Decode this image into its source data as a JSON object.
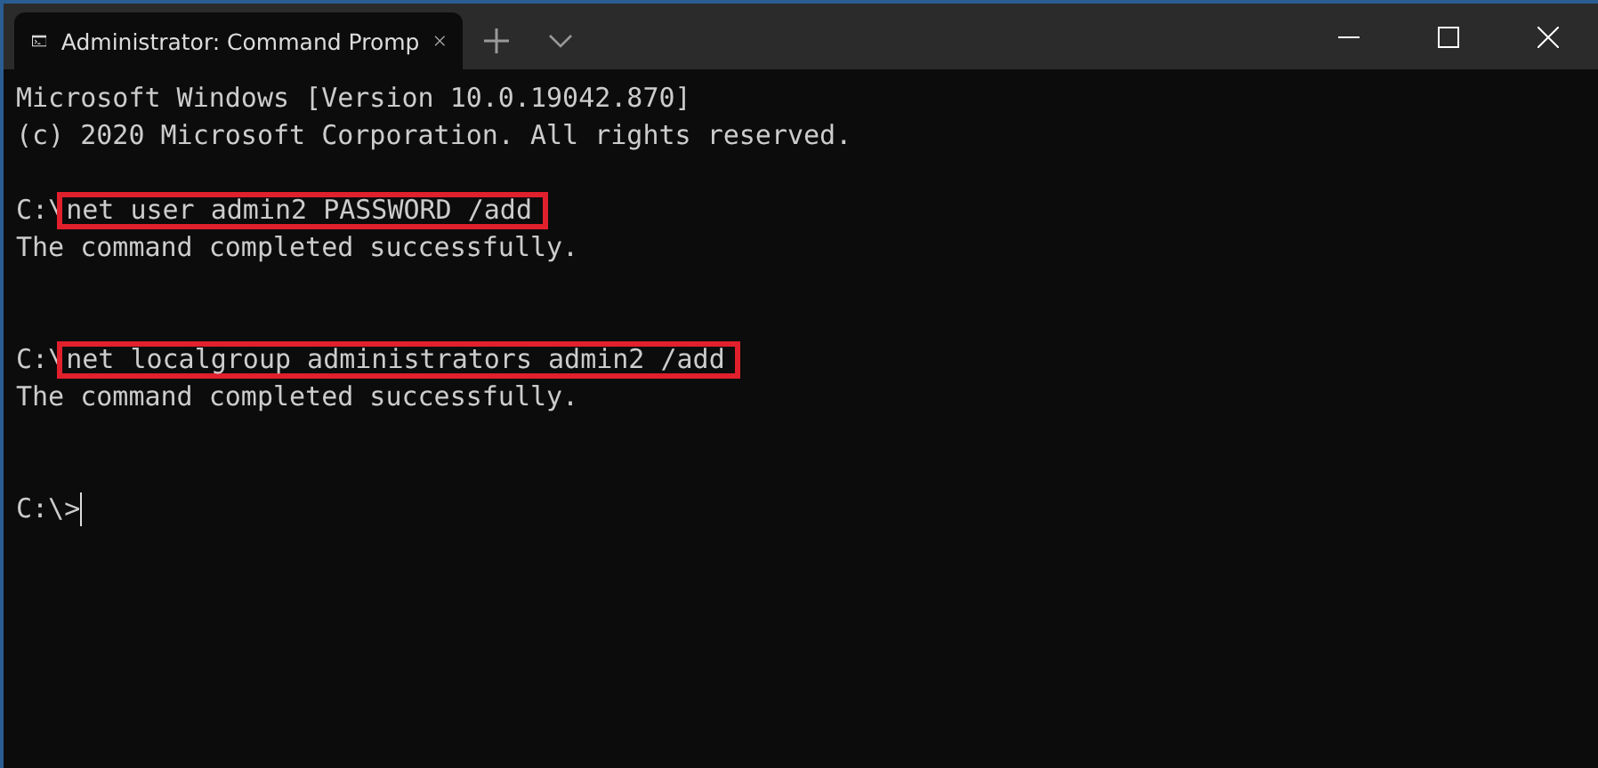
{
  "tab": {
    "title": "Administrator: Command Promp",
    "selected": true
  },
  "lines": [
    {
      "kind": "text",
      "text": "Microsoft Windows [Version 10.0.19042.870]"
    },
    {
      "kind": "text",
      "text": "(c) 2020 Microsoft Corporation. All rights reserved."
    },
    {
      "kind": "blank"
    },
    {
      "kind": "command",
      "prompt": "C:\\",
      "command": "net user admin2 PASSWORD /add",
      "highlighted": true
    },
    {
      "kind": "text",
      "text": "The command completed successfully."
    },
    {
      "kind": "blank"
    },
    {
      "kind": "blank"
    },
    {
      "kind": "command",
      "prompt": "C:\\",
      "command": "net localgroup administrators admin2 /add",
      "highlighted": true
    },
    {
      "kind": "text",
      "text": "The command completed successfully."
    },
    {
      "kind": "blank"
    },
    {
      "kind": "blank"
    },
    {
      "kind": "cursor",
      "prompt": "C:\\>"
    }
  ]
}
